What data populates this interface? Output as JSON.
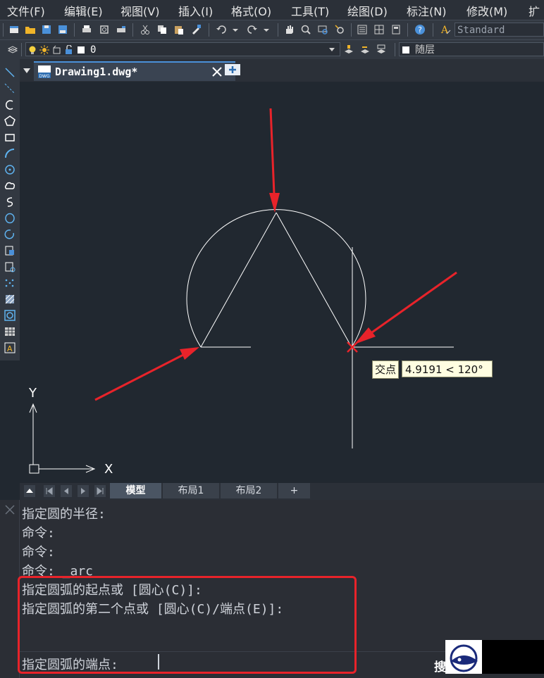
{
  "menu": {
    "items": [
      {
        "label": "文件(F)"
      },
      {
        "label": "编辑(E)"
      },
      {
        "label": "视图(V)"
      },
      {
        "label": "插入(I)"
      },
      {
        "label": "格式(O)"
      },
      {
        "label": "工具(T)"
      },
      {
        "label": "绘图(D)"
      },
      {
        "label": "标注(N)"
      },
      {
        "label": "修改(M)"
      },
      {
        "label": "扩"
      }
    ]
  },
  "toolbar": {
    "text_style": "Standard",
    "layer_value": "0",
    "linetype_value": "随层"
  },
  "tab": {
    "document_title": "Drawing1.dwg*"
  },
  "canvas": {
    "axis_y_label": "Y",
    "axis_x_label": "X",
    "tooltip": {
      "snap_label": "交点",
      "value": "4.9191 < 120°"
    }
  },
  "layout_tabs": {
    "items": [
      {
        "label": "模型",
        "active": true
      },
      {
        "label": "布局1",
        "active": false
      },
      {
        "label": "布局2",
        "active": false
      },
      {
        "label": "+",
        "active": false
      }
    ]
  },
  "command": {
    "lines": [
      "指定圆的半径:",
      "命令:",
      "命令:",
      "命令: _arc",
      "指定圆弧的起点或 [圆心(C)]:",
      "指定圆弧的第二个点或 [圆心(C)/端点(E)]:"
    ],
    "prompt": "指定圆弧的端点:",
    "search_char": "搜"
  },
  "colors": {
    "background": "#212830",
    "drawing_lines": "#ffffff",
    "annotation_red": "#e8232a",
    "tooltip_bg": "#fffee1"
  }
}
